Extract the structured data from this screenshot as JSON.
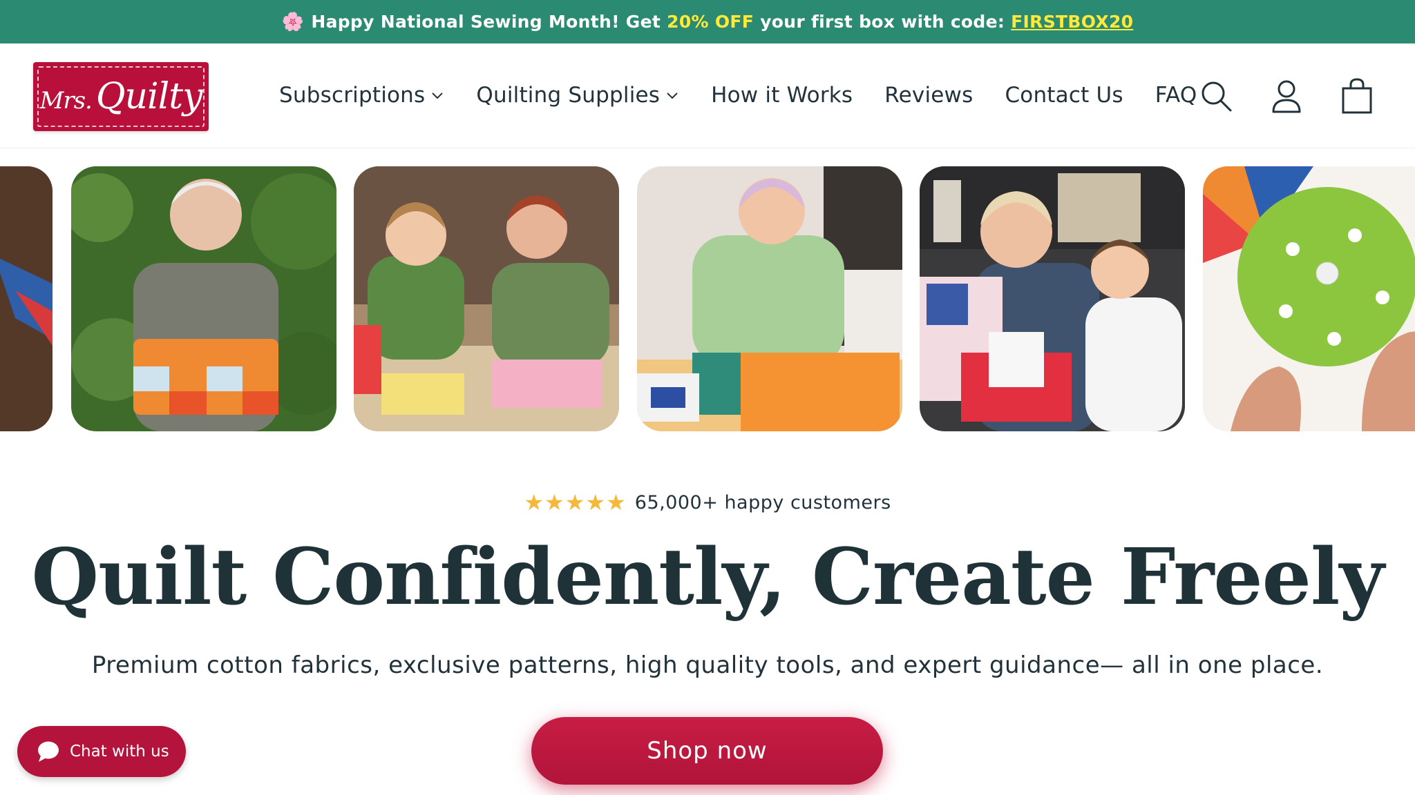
{
  "announcement": {
    "emoji": "🌸",
    "prefix": "Happy National Sewing Month! Get",
    "highlight": "20% OFF",
    "middle": "your first box with code:",
    "code": "FIRSTBOX20"
  },
  "logo": {
    "small": "Mrs.",
    "main": "Quilty"
  },
  "nav": {
    "items": [
      {
        "label": "Subscriptions",
        "dropdown": true
      },
      {
        "label": "Quilting Supplies",
        "dropdown": true
      },
      {
        "label": "How it Works",
        "dropdown": false
      },
      {
        "label": "Reviews",
        "dropdown": false
      },
      {
        "label": "Contact Us",
        "dropdown": false
      },
      {
        "label": "FAQ",
        "dropdown": false
      }
    ]
  },
  "header_icons": [
    "search-icon",
    "account-icon",
    "cart-icon"
  ],
  "carousel": {
    "images": [
      "quilted-item-partial",
      "woman-holding-patchwork-basket",
      "girl-and-woman-sewing",
      "woman-cutting-fabric",
      "grandmother-and-girl-with-quilty-box",
      "green-pincushion-partial"
    ]
  },
  "hero": {
    "stars": 5,
    "rating_text": "65,000+ happy customers",
    "headline": "Quilt Confidently, Create Freely",
    "subheadline": "Premium cotton fabrics, exclusive patterns, high quality tools, and expert guidance— all in one place.",
    "cta": "Shop now"
  },
  "chat": {
    "label": "Chat with us"
  },
  "colors": {
    "announcement_bg": "#2a8a72",
    "highlight": "#ffe93a",
    "brand": "#b8103a",
    "text": "#21323a",
    "star": "#f5b83a"
  }
}
